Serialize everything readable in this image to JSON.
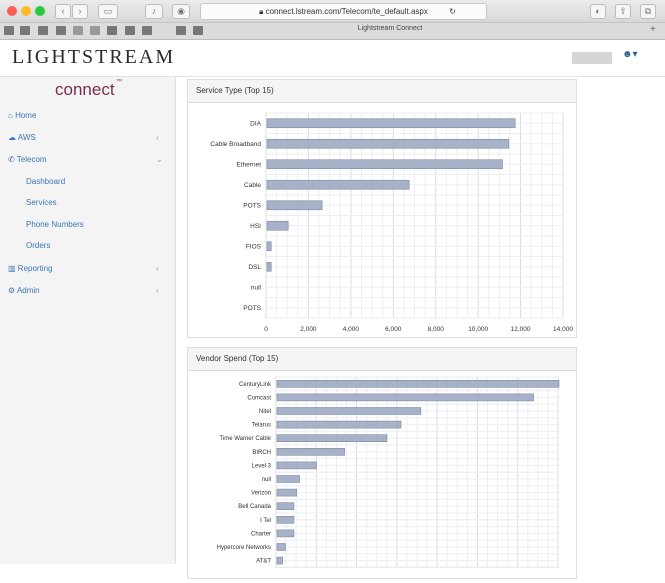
{
  "browser": {
    "url": "connect.lstream.com/Telecom/te_default.aspx",
    "tab_title": "Lightstream Connect"
  },
  "header": {
    "logo": "LIGHTSTREAM"
  },
  "sidebar": {
    "connect_logo": "connect",
    "items": [
      {
        "label": "Home",
        "icon": "home-icon"
      },
      {
        "label": "AWS",
        "icon": "cloud-icon"
      },
      {
        "label": "Telecom",
        "icon": "phone-icon"
      },
      {
        "label": "Dashboard"
      },
      {
        "label": "Services"
      },
      {
        "label": "Phone Numbers"
      },
      {
        "label": "Orders"
      },
      {
        "label": "Reporting",
        "icon": "chart-icon"
      },
      {
        "label": "Admin",
        "icon": "gear-icon"
      }
    ]
  },
  "chart_data": [
    {
      "type": "bar",
      "title": "Service Type (Top 15)",
      "categories": [
        "DIA",
        "Cable Broadband",
        "Ethernet",
        "Cable",
        "POTS",
        "HSI",
        "FIOS",
        "DSL",
        "null",
        "POTS"
      ],
      "values": [
        11700,
        11400,
        11100,
        6700,
        2600,
        1000,
        200,
        200,
        0,
        0
      ],
      "xlim": [
        0,
        14000
      ],
      "ticks": [
        "0",
        "2,000",
        "4,000",
        "6,000",
        "8,000",
        "10,000",
        "12,000",
        "14,000"
      ],
      "orientation": "horizontal",
      "grid": true,
      "color": "#a7b1c7"
    },
    {
      "type": "bar",
      "title": "Vendor Spend (Top 15)",
      "categories": [
        "CenturyLink",
        "Comcast",
        "Nitel",
        "Telarus",
        "Time Warner Cable",
        "BIRCH",
        "Level 3",
        "null",
        "Verizon",
        "Bell Canada",
        "I Tel",
        "Charter",
        "Hypercore Networks",
        "AT&T"
      ],
      "values": [
        100,
        91,
        51,
        44,
        39,
        24,
        14,
        8,
        7,
        6,
        6,
        6,
        3,
        2
      ],
      "orientation": "horizontal",
      "grid": true,
      "color": "#a7b1c7"
    }
  ]
}
